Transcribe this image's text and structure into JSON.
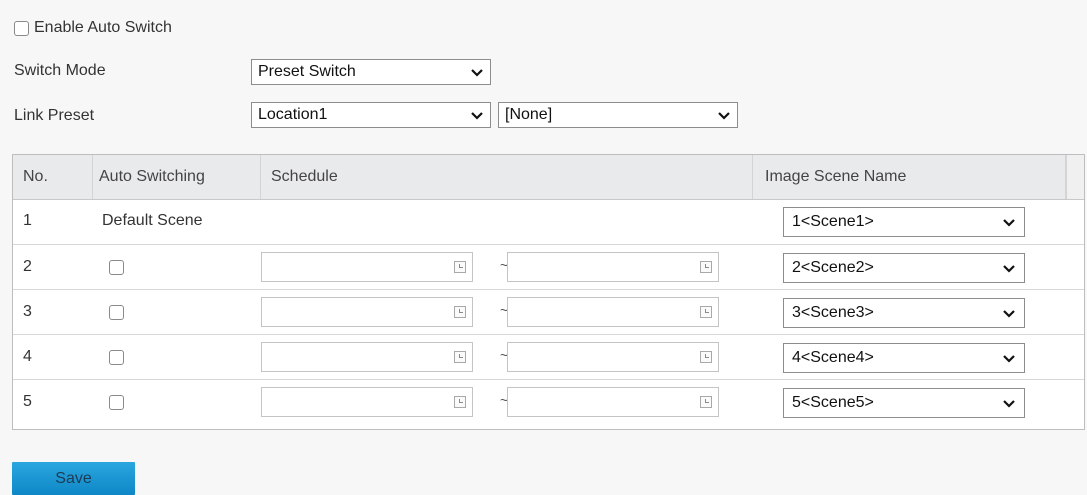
{
  "settings": {
    "enable_auto_switch_label": "Enable Auto Switch",
    "switch_mode_label": "Switch Mode",
    "switch_mode_value": "Preset Switch",
    "link_preset_label": "Link Preset",
    "link_preset_value": "Location1",
    "link_preset_secondary_value": "[None]"
  },
  "table": {
    "headers": {
      "no": "No.",
      "auto_switching": "Auto Switching",
      "schedule": "Schedule",
      "image_scene_name": "Image Scene Name"
    },
    "rows": [
      {
        "no": "1",
        "auto": "Default Scene",
        "scene": "1<Scene1>"
      },
      {
        "no": "2",
        "scene": "2<Scene2>"
      },
      {
        "no": "3",
        "scene": "3<Scene3>"
      },
      {
        "no": "4",
        "scene": "4<Scene4>"
      },
      {
        "no": "5",
        "scene": "5<Scene5>"
      }
    ],
    "schedule_separator": "~"
  },
  "actions": {
    "save_label": "Save"
  },
  "colors": {
    "save_button": "#1a96d4",
    "header_bg": "#e9eaec",
    "page_bg": "#f7f7f7"
  }
}
